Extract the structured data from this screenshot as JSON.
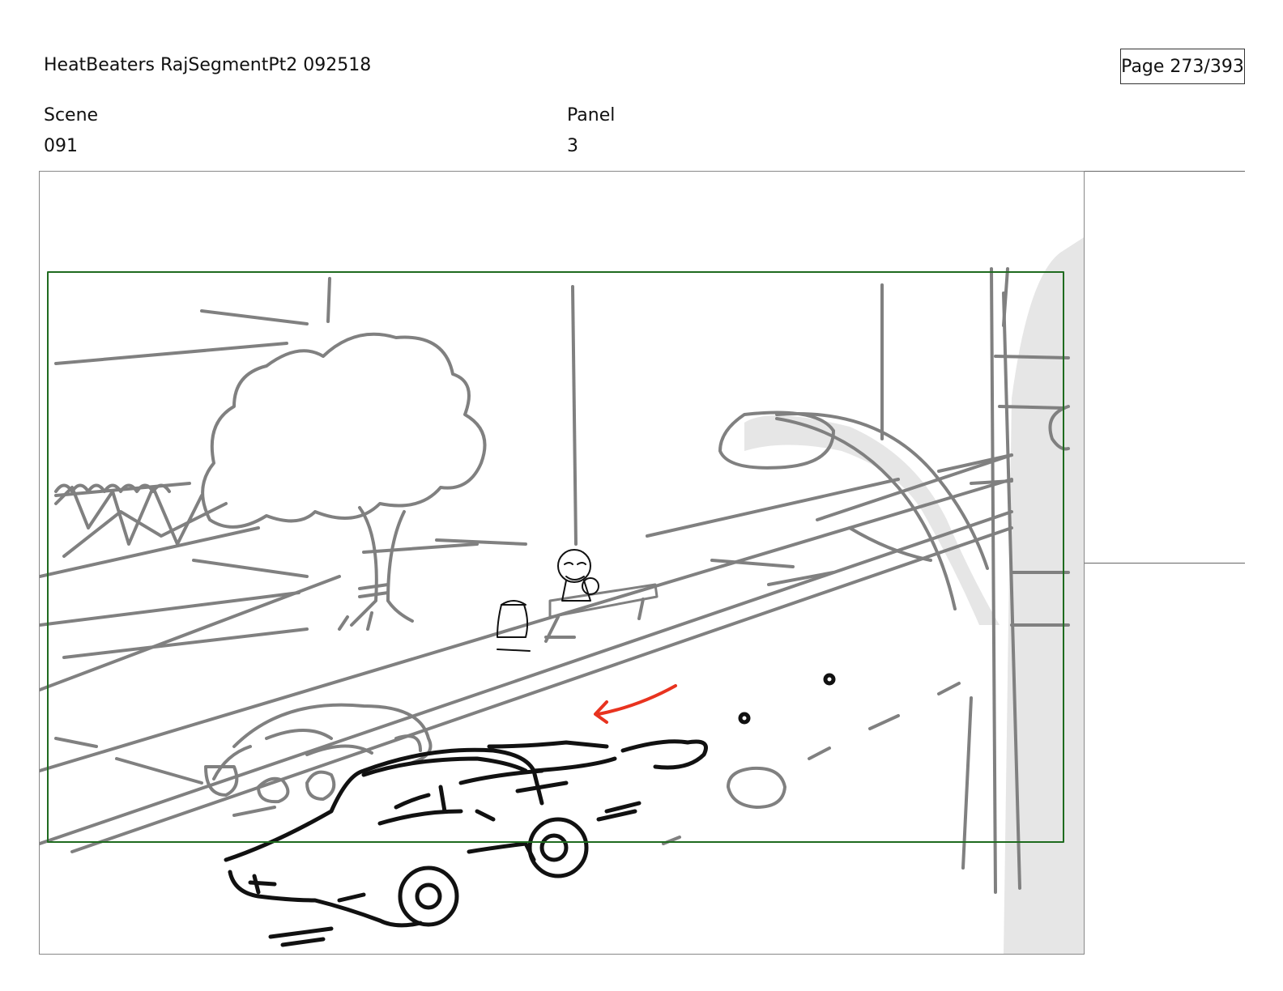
{
  "header": {
    "title": "HeatBeaters RajSegmentPt2 092518",
    "page": "Page 273/393"
  },
  "fields": {
    "scene_label": "Scene",
    "scene_value": "091",
    "panel_label": "Panel",
    "panel_value": "3"
  },
  "panel": {
    "image_name": "storyboard-sketch",
    "colors": {
      "pencil_gray": "#808080",
      "ink_black": "#111111",
      "action_arrow": "#e8331f",
      "safe_frame": "#1f6b1f",
      "pole_shade": "#e6e6e6"
    }
  }
}
